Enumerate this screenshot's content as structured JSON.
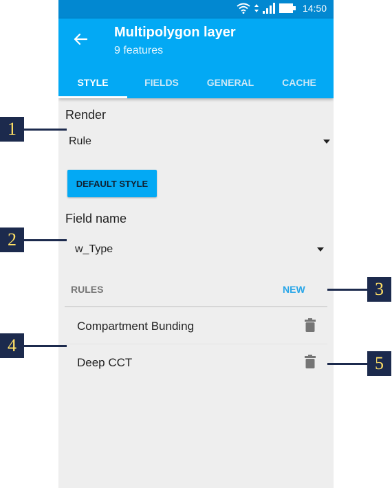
{
  "status_bar": {
    "time": "14:50"
  },
  "app_bar": {
    "title": "Multipolygon layer",
    "subtitle": "9 features"
  },
  "tabs": [
    {
      "label": "STYLE",
      "active": true
    },
    {
      "label": "FIELDS",
      "active": false
    },
    {
      "label": "GENERAL",
      "active": false
    },
    {
      "label": "CACHE",
      "active": false
    }
  ],
  "render": {
    "label": "Render",
    "value": "Rule"
  },
  "default_style_button": "DEFAULT STYLE",
  "field_name": {
    "label": "Field name",
    "value": "w_Type"
  },
  "rules": {
    "header": "RULES",
    "new_label": "NEW",
    "items": [
      {
        "label": "Compartment Bunding"
      },
      {
        "label": "Deep CCT"
      }
    ]
  },
  "callouts": [
    "1",
    "2",
    "3",
    "4",
    "5"
  ],
  "colors": {
    "app_bar": "#03a9f4",
    "status_bar": "#0288d1",
    "accent": "#29a6e8",
    "background": "#eeeeee",
    "callout_bg": "#1c2a4d",
    "callout_text": "#ffe066"
  }
}
